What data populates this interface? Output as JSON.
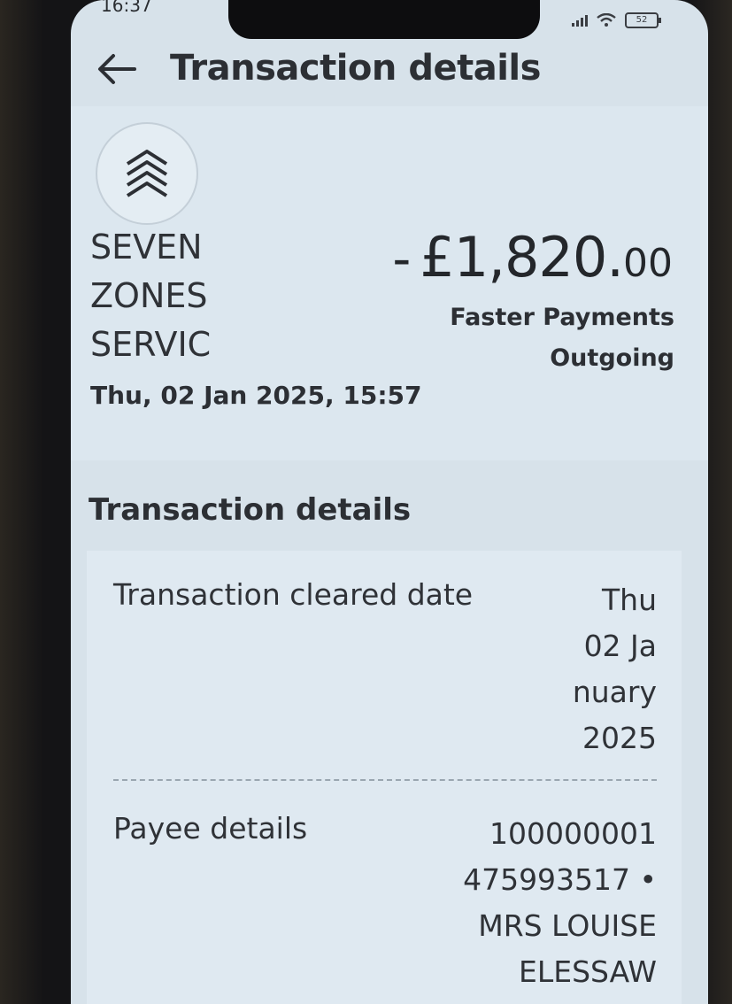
{
  "status_bar": {
    "time": "16:37",
    "battery": "52"
  },
  "header": {
    "title": "Transaction details"
  },
  "summary": {
    "merchant_name": "SEVEN ZONES SERVIC",
    "amount_sign": "-",
    "amount_major": "£1,820.",
    "amount_minor": "00",
    "payment_type_line1": "Faster Payments",
    "payment_type_line2": "Outgoing",
    "datetime": "Thu, 02 Jan 2025, 15:57"
  },
  "details": {
    "section_title": "Transaction details",
    "rows": [
      {
        "label": "Transaction cleared date",
        "value_lines": [
          "Thu",
          "02 Ja",
          "nuary",
          "2025"
        ]
      },
      {
        "label": "Payee details",
        "value_lines": [
          "100000001",
          "475993517 •",
          "MRS LOUISE",
          "ELESSAW"
        ]
      }
    ]
  },
  "icons": {
    "back": "arrow-left-icon",
    "merchant": "chevrons-up-icon",
    "signal": "signal-icon",
    "wifi": "wifi-icon",
    "battery": "battery-icon"
  }
}
